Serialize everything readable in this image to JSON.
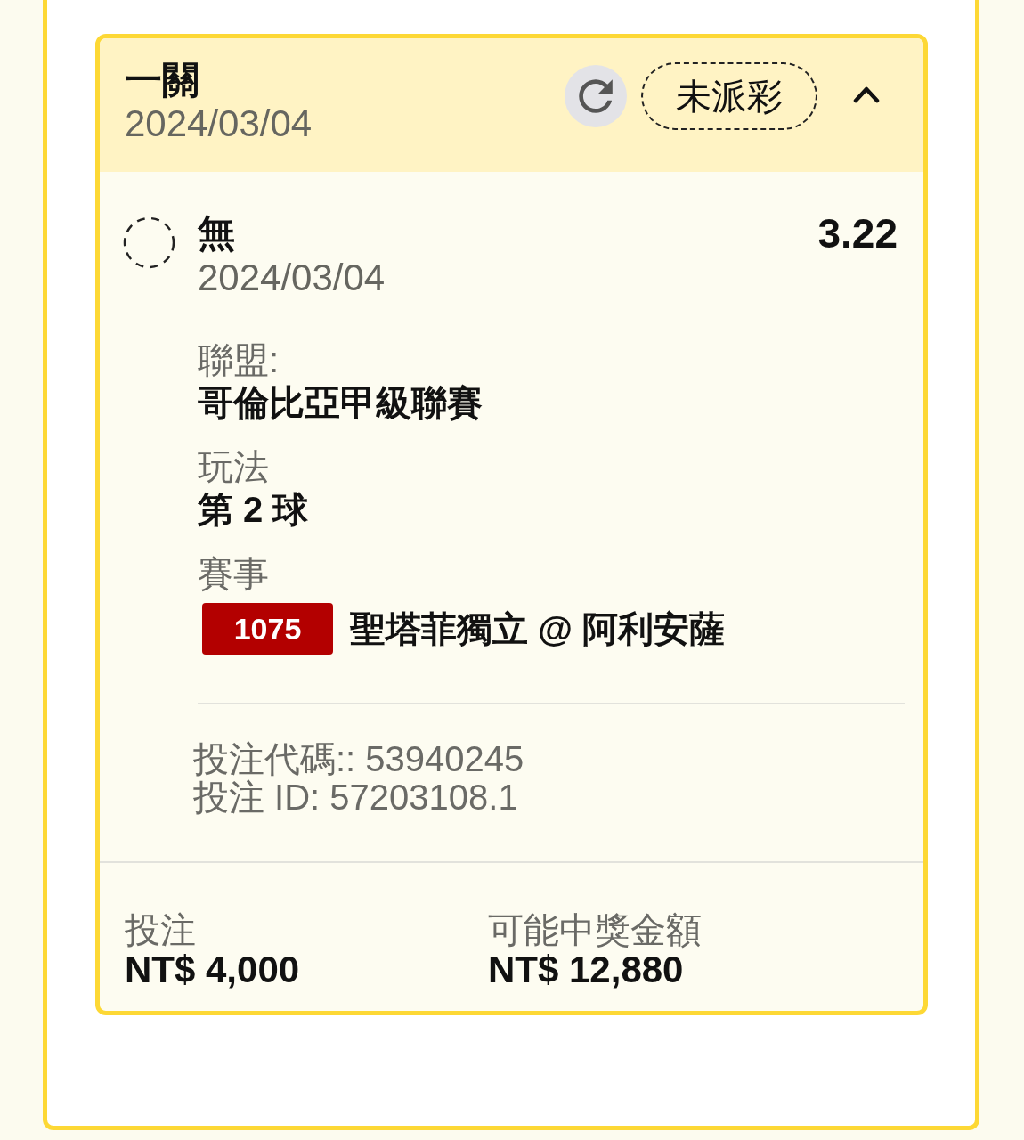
{
  "bet": {
    "title": "一關",
    "date": "2024/03/04",
    "status": "未派彩",
    "expanded": true
  },
  "selection": {
    "name": "無",
    "date": "2024/03/04",
    "odds": "3.22",
    "selected": false
  },
  "details": [
    {
      "kind": "text",
      "label": "聯盟:",
      "value": "哥倫比亞甲級聯賽"
    },
    {
      "kind": "text",
      "label": "玩法",
      "value": "第 2 球"
    },
    {
      "kind": "match",
      "label": "賽事",
      "badge": "1075",
      "value": "聖塔菲獨立 @ 阿利安薩"
    }
  ],
  "references": [
    "投注代碼:: 53940245",
    "投注 ID: 57203108.1"
  ],
  "totals": [
    {
      "label": "投注",
      "value": "NT$ 4,000"
    },
    {
      "label": "可能中獎金額",
      "value": "NT$ 12,880"
    }
  ]
}
